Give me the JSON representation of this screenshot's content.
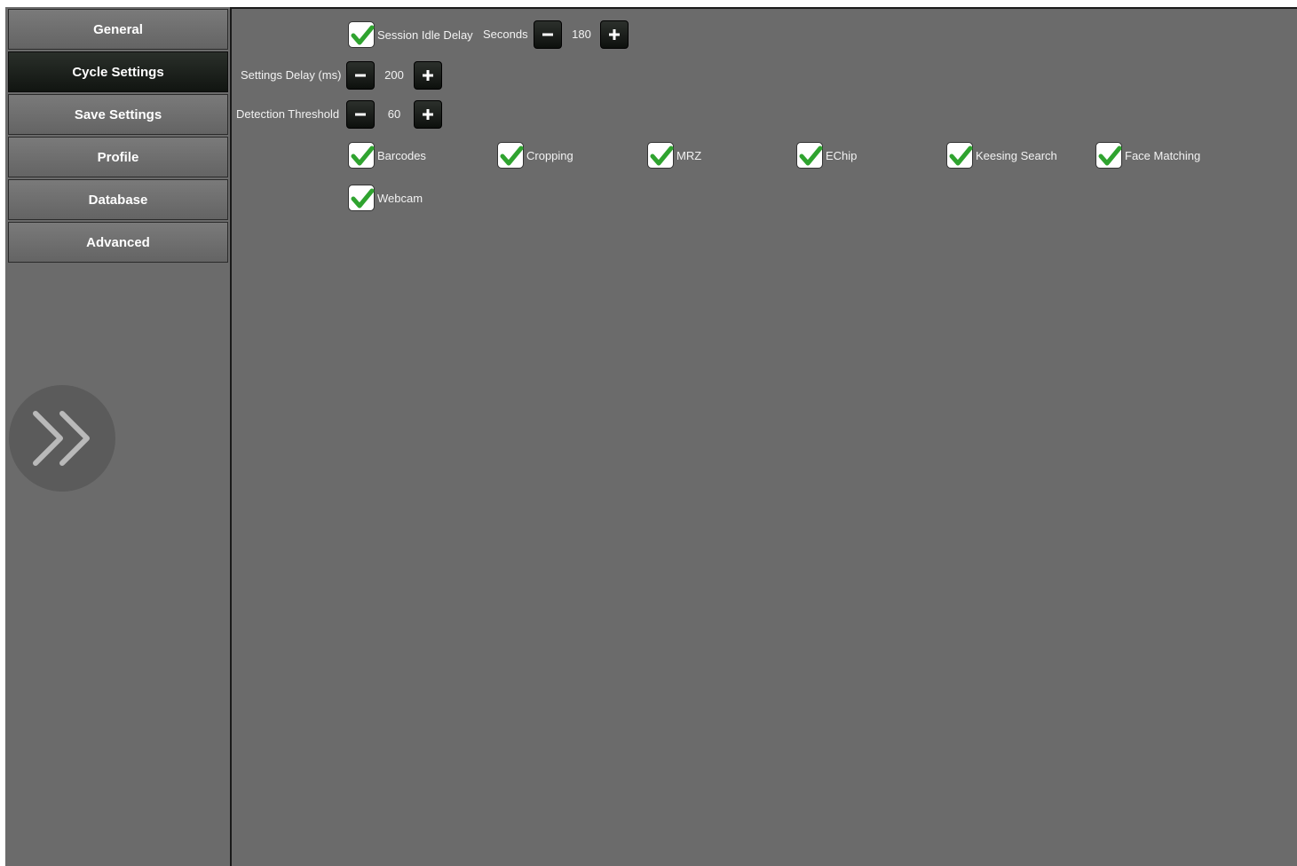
{
  "sidebar": {
    "items": [
      {
        "label": "General",
        "active": false
      },
      {
        "label": "Cycle Settings",
        "active": true
      },
      {
        "label": "Save Settings",
        "active": false
      },
      {
        "label": "Profile",
        "active": false
      },
      {
        "label": "Database",
        "active": false
      },
      {
        "label": "Advanced",
        "active": false
      }
    ],
    "expand_icon": "double-chevron-right-icon"
  },
  "session": {
    "checkbox_label": "Session Idle Delay",
    "checked": true,
    "unit_label": "Seconds",
    "value": "180"
  },
  "settings_delay": {
    "label": "Settings Delay (ms)",
    "value": "200"
  },
  "detection_threshold": {
    "label": "Detection Threshold",
    "value": "60"
  },
  "features": [
    {
      "label": "Barcodes",
      "checked": true
    },
    {
      "label": "Cropping",
      "checked": true
    },
    {
      "label": "MRZ",
      "checked": true
    },
    {
      "label": "EChip",
      "checked": true
    },
    {
      "label": "Keesing Search",
      "checked": true
    },
    {
      "label": "Face Matching",
      "checked": true
    },
    {
      "label": "Webcam",
      "checked": true
    }
  ],
  "colors": {
    "background": "#6b6b6b",
    "active_tab": "#111511",
    "checkmark": "#2fa32f"
  }
}
